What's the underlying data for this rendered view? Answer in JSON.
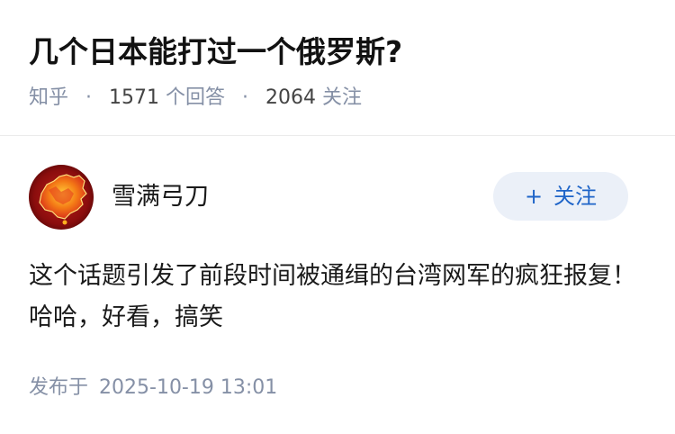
{
  "question": {
    "title": "几个日本能打过一个俄罗斯?",
    "source": "知乎",
    "answer_count": "1571",
    "answer_label": "个回答",
    "follower_count": "2064",
    "follower_label": "关注"
  },
  "answer": {
    "author_name": "雪满弓刀",
    "follow_label": "关注",
    "follow_icon": "plus-icon",
    "content": "这个话题引发了前段时间被通缉的台湾网军的疯狂报复！哈哈，好看，搞笑",
    "published_label": "发布于",
    "published_time": "2025-10-19 13:01"
  },
  "colors": {
    "accent": "#1e64c8",
    "meta_gray": "#8590a6",
    "follow_bg": "#ebf0f8"
  }
}
